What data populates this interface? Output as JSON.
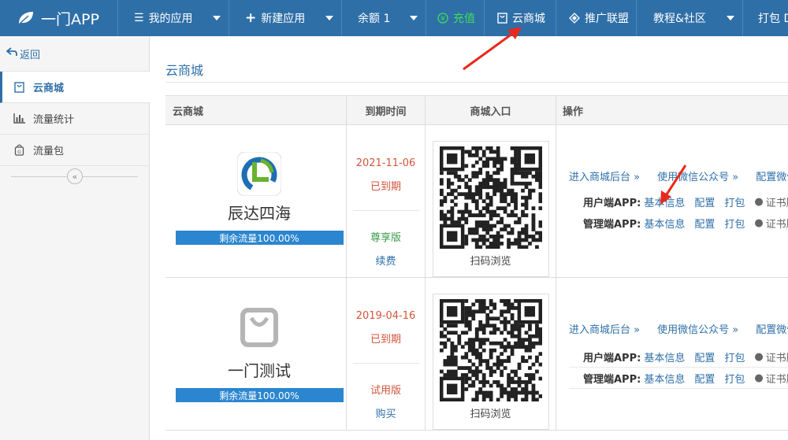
{
  "brand": {
    "name": "一门APP"
  },
  "nav": {
    "my_apps": "我的应用",
    "new_app": "新建应用",
    "balance": "余额 1",
    "recharge": "充值",
    "cloud_mall": "云商城",
    "affiliate": "推广联盟",
    "tutorial": "教程&社区",
    "pack": "打包 D"
  },
  "sidebar": {
    "back": "返回",
    "items": [
      {
        "label": "云商城"
      },
      {
        "label": "流量统计"
      },
      {
        "label": "流量包"
      }
    ]
  },
  "main": {
    "title": "云商城",
    "table": {
      "headers": [
        "云商城",
        "到期时间",
        "商城入口",
        "操作"
      ],
      "rows": [
        {
          "name": "辰达四海",
          "flow": "剩余流量100.00%",
          "date": "2021-11-06",
          "status": "已到期",
          "edition": "尊享版",
          "action": "续费",
          "qr_caption": "扫码浏览",
          "links": [
            "进入商城后台 »",
            "使用微信公众号 »",
            "配置微信"
          ],
          "user_app": {
            "label": "用户端APP:",
            "info": "基本信息",
            "config": "配置",
            "pack": "打包",
            "cert": "证书版"
          },
          "admin_app": {
            "label": "管理端APP:",
            "info": "基本信息",
            "config": "配置",
            "pack": "打包",
            "cert": "证书版"
          }
        },
        {
          "name": "一门测试",
          "flow": "剩余流量100.00%",
          "date": "2019-04-16",
          "status": "已到期",
          "edition": "试用版",
          "action": "购买",
          "qr_caption": "扫码浏览",
          "links": [
            "进入商城后台 »",
            "使用微信公众号 »",
            "配置微信"
          ],
          "user_app": {
            "label": "用户端APP:",
            "info": "基本信息",
            "config": "配置",
            "pack": "打包",
            "cert": "证书版"
          },
          "admin_app": {
            "label": "管理端APP:",
            "info": "基本信息",
            "config": "配置",
            "pack": "打包",
            "cert": "证书版"
          }
        }
      ]
    }
  },
  "colors": {
    "nav_bg": "#2f6fa8",
    "link": "#2f6fa8",
    "expired": "#d4553b",
    "premium": "#3a9a48",
    "flow_bar": "#2b86cf",
    "annotation_arrow": "#e8291c"
  }
}
